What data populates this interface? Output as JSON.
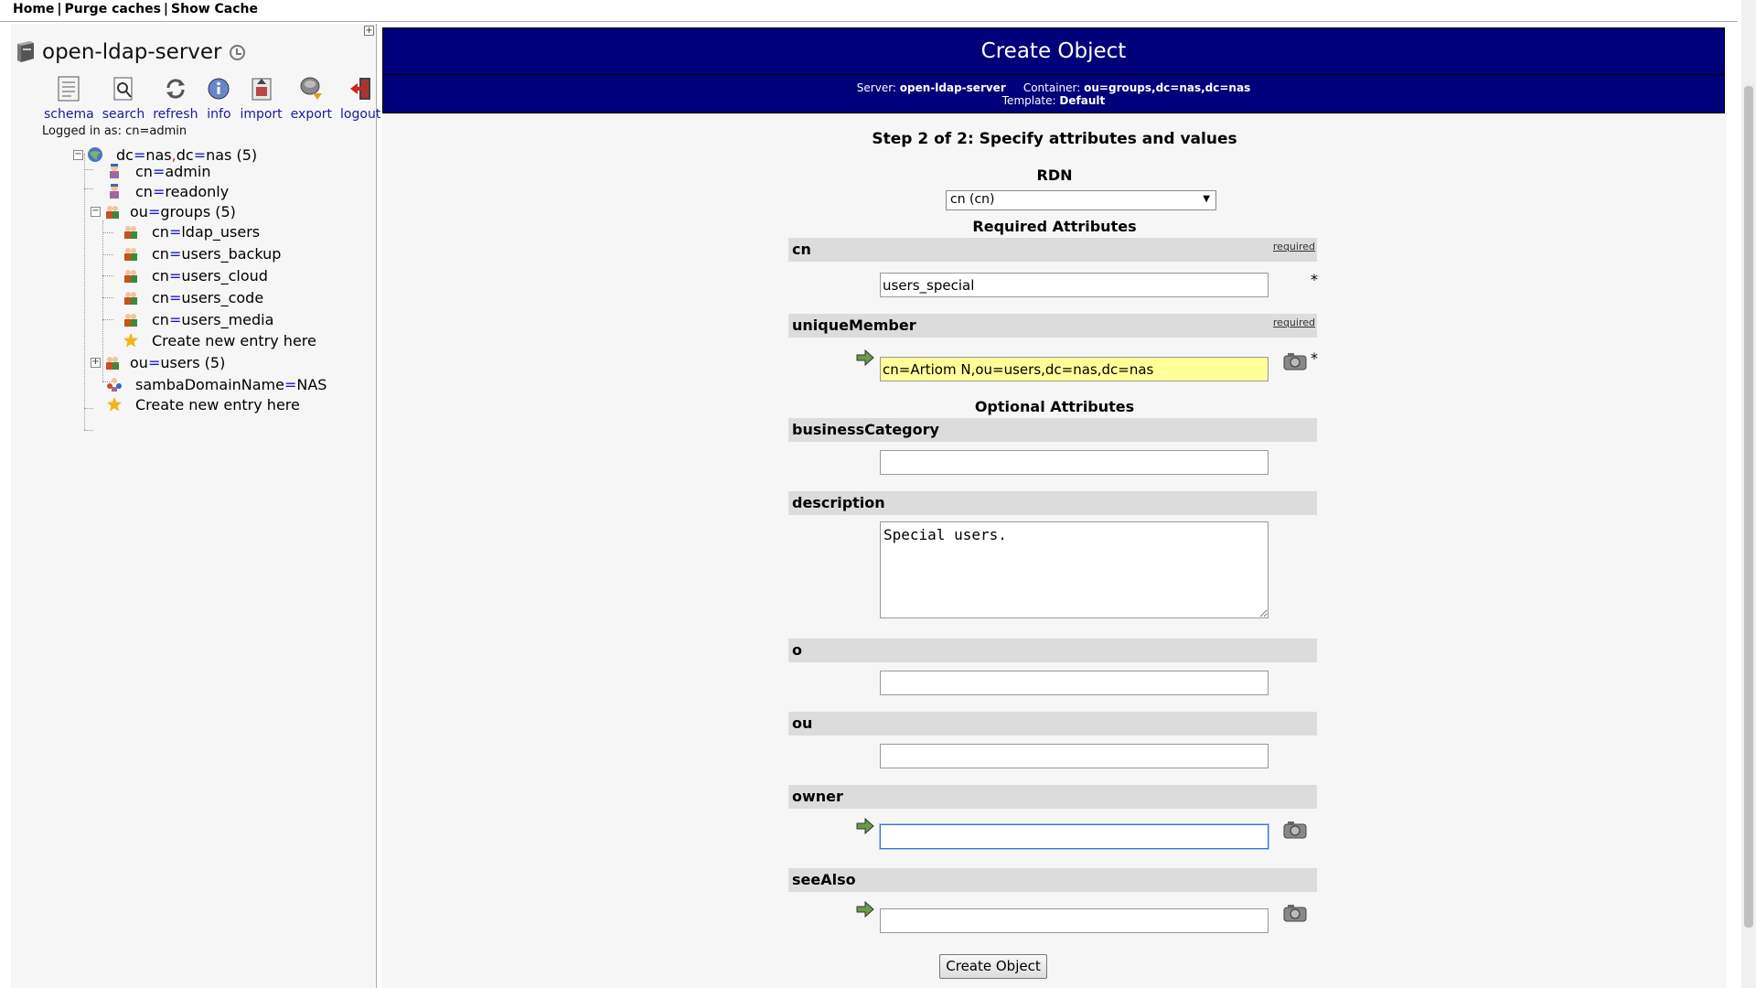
{
  "topnav": {
    "home": "Home",
    "purge": "Purge caches",
    "show_cache": "Show Cache",
    "sep": "|"
  },
  "sidebar": {
    "server_name": "open-ldap-server",
    "tools": [
      {
        "label": "schema",
        "icon": "schema-icon"
      },
      {
        "label": "search",
        "icon": "search-icon"
      },
      {
        "label": "refresh",
        "icon": "refresh-icon"
      },
      {
        "label": "info",
        "icon": "info-icon"
      },
      {
        "label": "import",
        "icon": "import-icon"
      },
      {
        "label": "export",
        "icon": "export-icon"
      },
      {
        "label": "logout",
        "icon": "logout-icon"
      }
    ],
    "logged_in": "Logged in as: cn=admin",
    "tree": {
      "root": {
        "a": "dc",
        "b": "nas",
        "c": "dc",
        "d": "nas",
        "count": "(5)"
      },
      "admin": {
        "attr": "cn",
        "val": "admin"
      },
      "readonly": {
        "attr": "cn",
        "val": "readonly"
      },
      "groups": {
        "attr": "ou",
        "val": "groups",
        "count": "(5)"
      },
      "group_items": [
        {
          "attr": "cn",
          "val": "ldap_users"
        },
        {
          "attr": "cn",
          "val": "users_backup"
        },
        {
          "attr": "cn",
          "val": "users_cloud"
        },
        {
          "attr": "cn",
          "val": "users_code"
        },
        {
          "attr": "cn",
          "val": "users_media"
        }
      ],
      "create_inner": "Create new entry here",
      "users": {
        "attr": "ou",
        "val": "users",
        "count": "(5)"
      },
      "samba": {
        "attr": "sambaDomainName",
        "val": "NAS"
      },
      "create_outer": "Create new entry here"
    }
  },
  "main": {
    "title": "Create Object",
    "server_label": "Server:",
    "server_value": "open-ldap-server",
    "container_label": "Container:",
    "container_value": "ou=groups,dc=nas,dc=nas",
    "template_label": "Template:",
    "template_value": "Default",
    "step": "Step 2 of 2: Specify attributes and values",
    "rdn_label": "RDN",
    "rdn_selected": "cn (cn)",
    "required_title": "Required Attributes",
    "optional_title": "Optional Attributes",
    "required_tag": "required",
    "required_mark": "*",
    "attrs": {
      "cn": {
        "name": "cn",
        "value": "users_special"
      },
      "uniqueMember": {
        "name": "uniqueMember",
        "value": "cn=Artiom N,ou=users,dc=nas,dc=nas"
      },
      "businessCategory": {
        "name": "businessCategory",
        "value": ""
      },
      "description": {
        "name": "description",
        "value": "Special users."
      },
      "o": {
        "name": "o",
        "value": ""
      },
      "ou": {
        "name": "ou",
        "value": ""
      },
      "owner": {
        "name": "owner",
        "value": ""
      },
      "seeAlso": {
        "name": "seeAlso",
        "value": ""
      }
    },
    "submit": "Create Object"
  },
  "colors": {
    "header_bg": "#00007a",
    "highlight_field": "#ffff99",
    "link_blue": "#1a1a9a"
  }
}
